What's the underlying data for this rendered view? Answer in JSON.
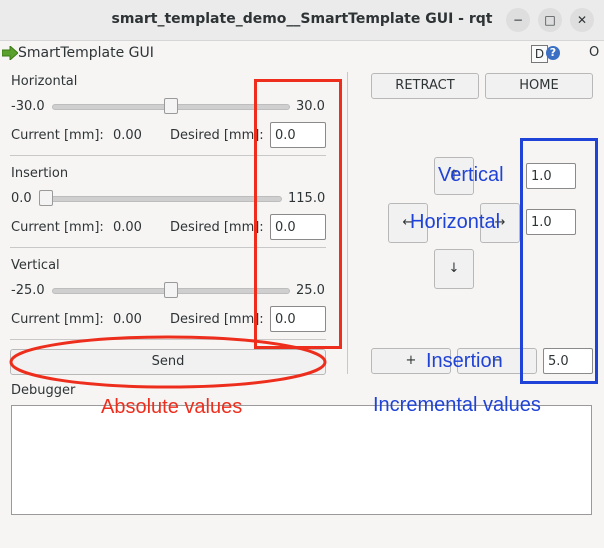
{
  "window": {
    "title": "smart_template_demo__SmartTemplate GUI - rqt",
    "controls": {
      "minimize": "−",
      "maximize": "□",
      "close": "✕"
    }
  },
  "plugin": {
    "name": "SmartTemplate GUI",
    "help": "D",
    "help_icon": "?",
    "close": "O"
  },
  "absolute": {
    "horizontal": {
      "label": "Horizontal",
      "min": "-30.0",
      "max": "30.0",
      "slider_value": 0.0,
      "current_label": "Current [mm]:",
      "current_value": "0.00",
      "desired_label": "Desired [mm]:",
      "desired_value": "0.0"
    },
    "insertion": {
      "label": "Insertion",
      "min": "0.0",
      "max": "115.0",
      "slider_value": 0.0,
      "current_label": "Current [mm]:",
      "current_value": "0.00",
      "desired_label": "Desired [mm]:",
      "desired_value": "0.0"
    },
    "vertical": {
      "label": "Vertical",
      "min": "-25.0",
      "max": "25.0",
      "slider_value": 0.0,
      "current_label": "Current [mm]:",
      "current_value": "0.00",
      "desired_label": "Desired [mm]:",
      "desired_value": "0.0"
    },
    "send_label": "Send"
  },
  "incremental": {
    "retract_label": "RETRACT",
    "home_label": "HOME",
    "up_label": "↑",
    "down_label": "↓",
    "left_label": "←",
    "right_label": "→",
    "vertical_step": "1.0",
    "horizontal_step": "1.0",
    "insertion_plus": "+",
    "insertion_minus": "−",
    "insertion_step": "5.0"
  },
  "debugger": {
    "label": "Debugger",
    "text": ""
  },
  "annotations": {
    "vertical": "Vertical",
    "horizontal": "Horizontal",
    "insertion": "Insertion",
    "absolute_values": "Absolute values",
    "incremental_values": "Incremental values",
    "red": "#ee2e1d",
    "blue": "#1f43d6"
  }
}
